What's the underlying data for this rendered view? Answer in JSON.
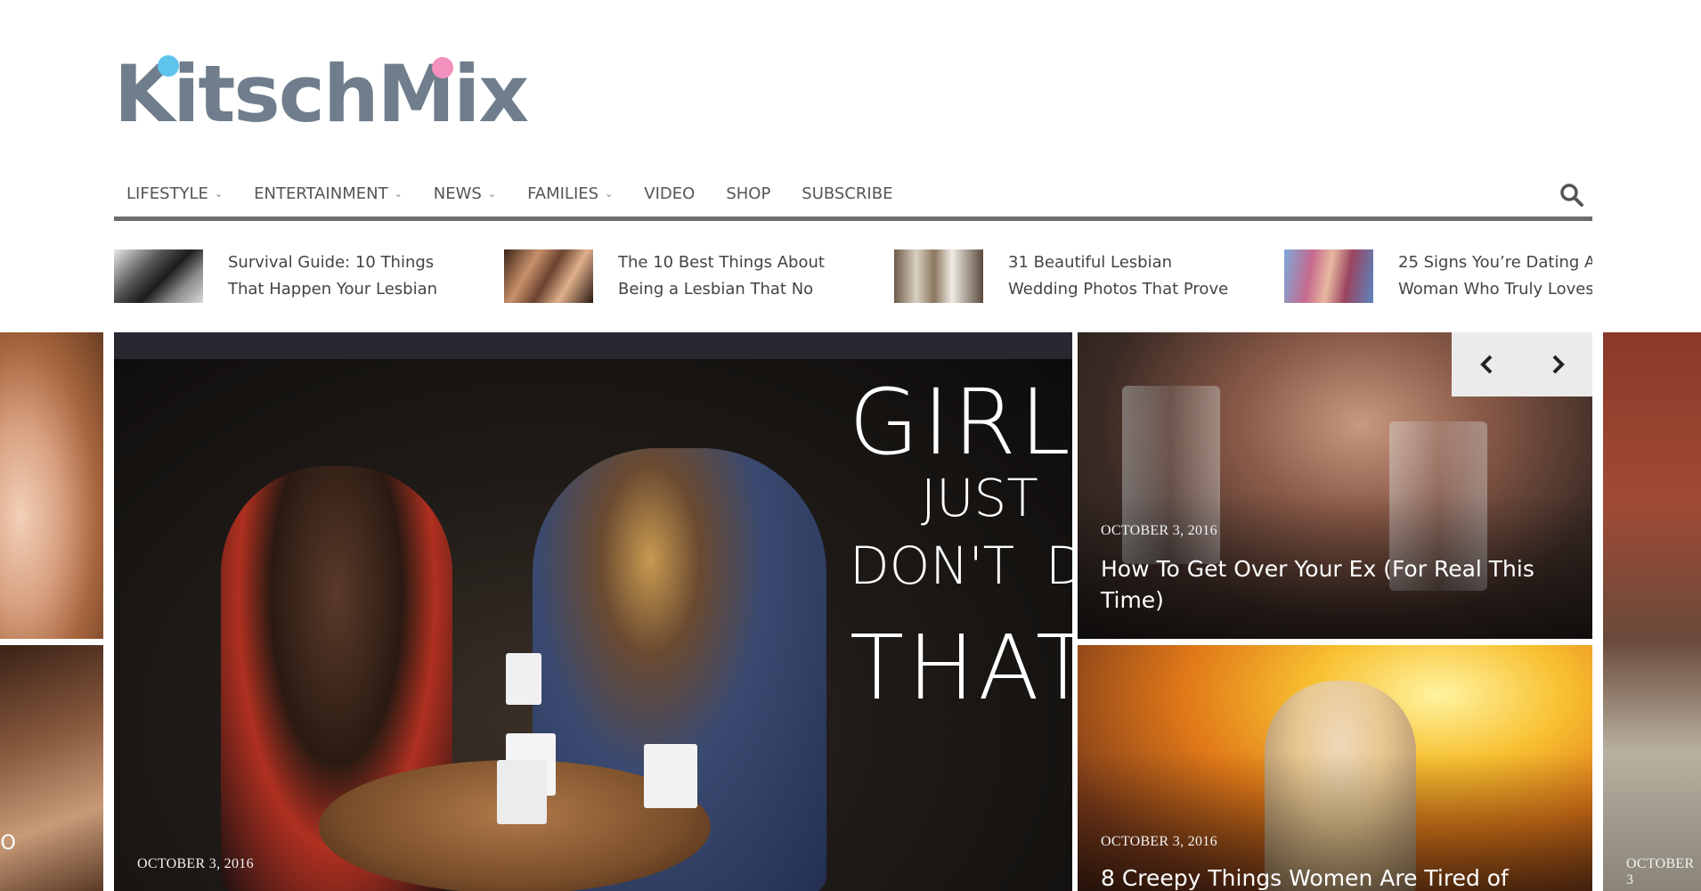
{
  "logo": {
    "text": "KitschMix"
  },
  "nav": {
    "items": [
      {
        "label": "LIFESTYLE",
        "dropdown": true
      },
      {
        "label": "ENTERTAINMENT",
        "dropdown": true
      },
      {
        "label": "NEWS",
        "dropdown": true
      },
      {
        "label": "FAMILIES",
        "dropdown": true
      },
      {
        "label": "VIDEO",
        "dropdown": false
      },
      {
        "label": "SHOP",
        "dropdown": false
      },
      {
        "label": "SUBSCRIBE",
        "dropdown": false
      }
    ],
    "search_icon": "search-icon"
  },
  "recent": [
    {
      "line1": "Survival Guide: 10 Things",
      "line2": "That Happen Your Lesbian"
    },
    {
      "line1": "The 10 Best Things About",
      "line2": "Being a Lesbian That No"
    },
    {
      "line1": "31 Beautiful Lesbian",
      "line2": "Wedding Photos That Prove"
    },
    {
      "line1": "25 Signs You’re Dating A",
      "line2": "Woman Who Truly Loves"
    }
  ],
  "slider": {
    "left_partial": {
      "text": "IO"
    },
    "main": {
      "date": "OCTOBER 3, 2016",
      "overlay": [
        "GIRLS",
        "JUST",
        "DON'T",
        "D",
        "THAT"
      ]
    },
    "top_right": {
      "date": "OCTOBER 3, 2016",
      "title": "How To Get Over Your Ex (For Real This Time)"
    },
    "bottom_right": {
      "date": "OCTOBER 3, 2016",
      "title": "8 Creepy Things Women Are Tired of"
    },
    "right_partial": {
      "date": "OCTOBER 3"
    }
  },
  "colors": {
    "nav_rule": "#6d6d6d",
    "logo": "#6f7d8c",
    "logo_dot_blue": "#5ec4ec",
    "logo_dot_pink": "#f490bd"
  }
}
